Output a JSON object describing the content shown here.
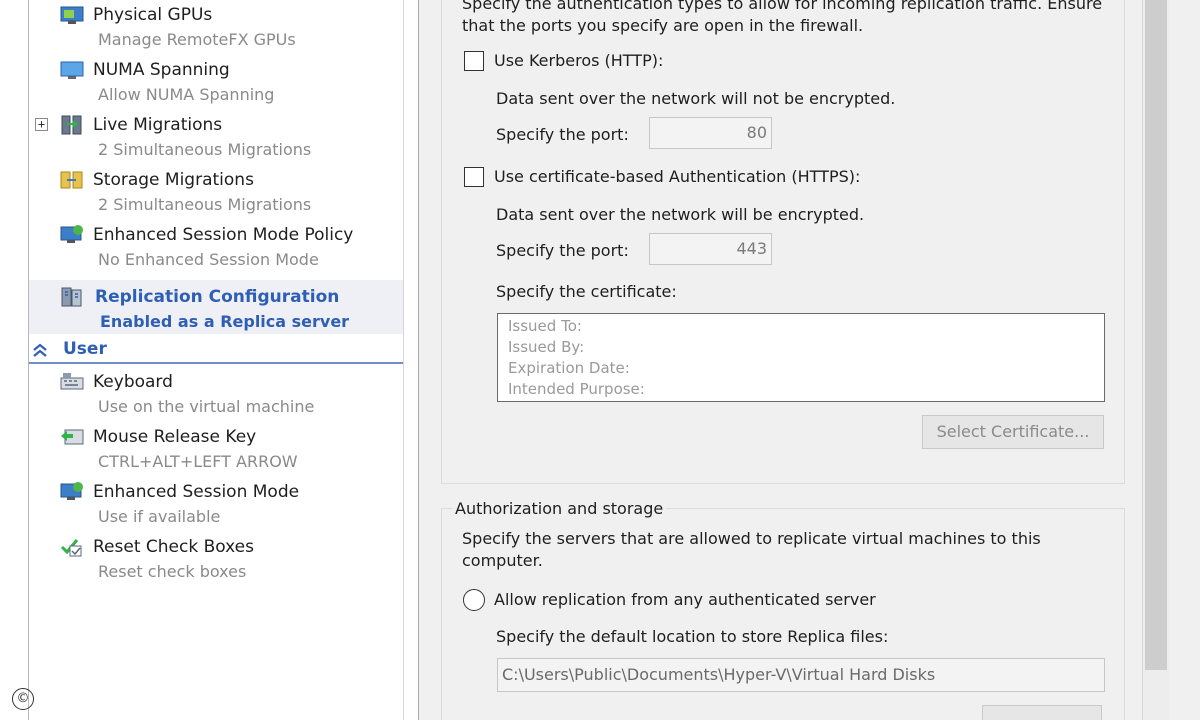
{
  "nav": {
    "items": [
      {
        "id": "physical-gpus",
        "title": "Physical GPUs",
        "sub": "Manage RemoteFX GPUs"
      },
      {
        "id": "numa-spanning",
        "title": "NUMA Spanning",
        "sub": "Allow NUMA Spanning"
      },
      {
        "id": "live-migrations",
        "title": "Live Migrations",
        "sub": "2 Simultaneous Migrations",
        "expander": "+"
      },
      {
        "id": "storage-migrations",
        "title": "Storage Migrations",
        "sub": "2 Simultaneous Migrations"
      },
      {
        "id": "enhanced-session-mode-policy",
        "title": "Enhanced Session Mode Policy",
        "sub": "No Enhanced Session Mode"
      },
      {
        "id": "replication-configuration",
        "title": "Replication Configuration",
        "sub": "Enabled as a Replica server"
      }
    ],
    "user_section": {
      "label": "User"
    },
    "user_items": [
      {
        "id": "keyboard",
        "title": "Keyboard",
        "sub": "Use on the virtual machine"
      },
      {
        "id": "mouse-release-key",
        "title": "Mouse Release Key",
        "sub": "CTRL+ALT+LEFT ARROW"
      },
      {
        "id": "enhanced-session-mode",
        "title": "Enhanced Session Mode",
        "sub": "Use if available"
      },
      {
        "id": "reset-check-boxes",
        "title": "Reset Check Boxes",
        "sub": "Reset check boxes"
      }
    ],
    "copyright": "©"
  },
  "auth": {
    "intro_line1": "Specify the authentication types to allow for incoming replication traffic. Ensure",
    "intro_line2": "that the ports you specify are open in the firewall.",
    "kerberos": {
      "label": "Use Kerberos (HTTP):",
      "desc": "Data sent over the network will not be encrypted.",
      "port_label": "Specify the port:",
      "port_value": "80"
    },
    "cert": {
      "label": "Use certificate-based Authentication (HTTPS):",
      "desc": "Data sent over the network will be encrypted.",
      "port_label": "Specify the port:",
      "port_value": "443",
      "cert_label": "Specify the certificate:",
      "issued_to": "Issued To:",
      "issued_by": "Issued By:",
      "expiration": "Expiration Date:",
      "purpose": "Intended Purpose:",
      "select_button": "Select Certificate..."
    }
  },
  "storage": {
    "title": "Authorization and storage",
    "intro_line1": "Specify the servers that are allowed to replicate virtual machines to this",
    "intro_line2": "computer.",
    "allow_any_label": "Allow replication from any authenticated server",
    "default_location_label": "Specify the default location to store Replica files:",
    "default_location_value": "C:\\Users\\Public\\Documents\\Hyper-V\\Virtual Hard Disks"
  }
}
